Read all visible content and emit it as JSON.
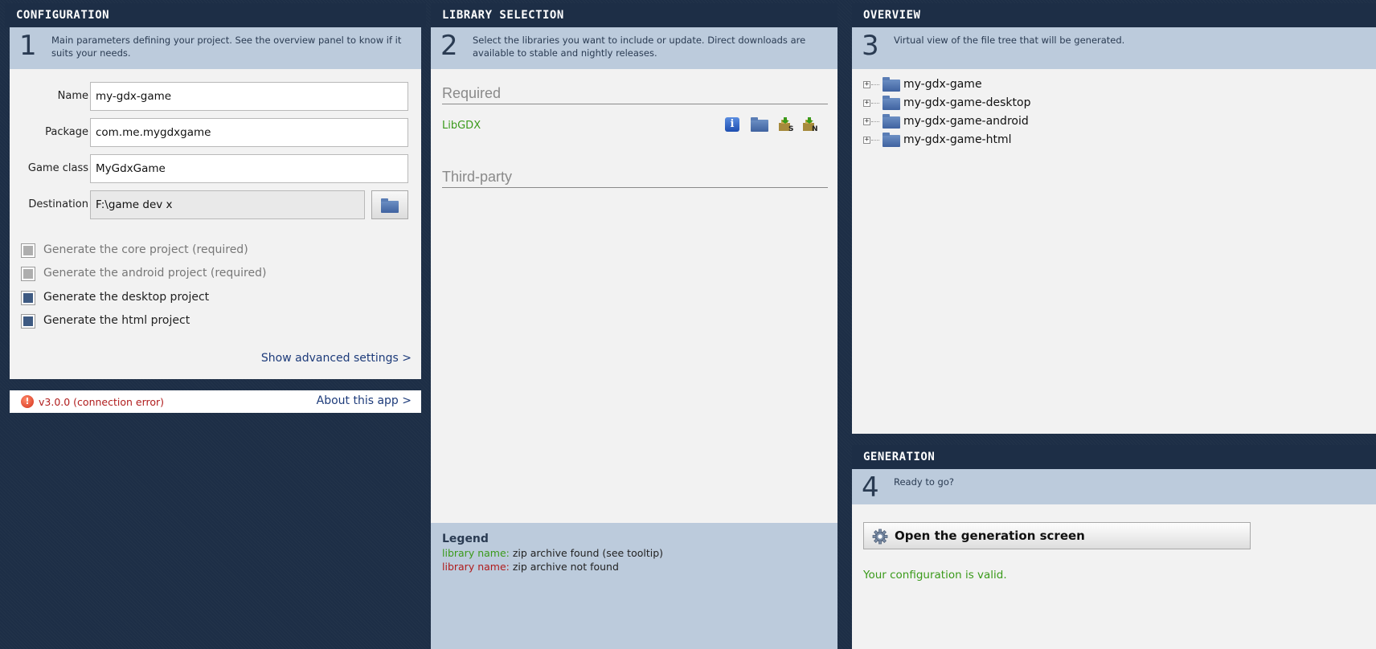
{
  "configuration": {
    "header": "CONFIGURATION",
    "step_number": "1",
    "step_text": "Main parameters defining your project. See the overview panel to know if it suits your needs.",
    "fields": {
      "name_label": "Name",
      "name_value": "my-gdx-game",
      "package_label": "Package",
      "package_value": "com.me.mygdxgame",
      "gameclass_label": "Game class",
      "gameclass_value": "MyGdxGame",
      "destination_label": "Destination",
      "destination_value": "F:\\game dev x"
    },
    "checkboxes": [
      {
        "label": "Generate the core project (required)",
        "checked": false,
        "disabled": true
      },
      {
        "label": "Generate the android project (required)",
        "checked": false,
        "disabled": true
      },
      {
        "label": "Generate the desktop project",
        "checked": true,
        "disabled": false
      },
      {
        "label": "Generate the html project",
        "checked": true,
        "disabled": false
      }
    ],
    "advanced_link": "Show advanced settings >",
    "status": {
      "version_text": "v3.0.0 (connection error)",
      "about_link": "About this app >"
    }
  },
  "library": {
    "header": "LIBRARY SELECTION",
    "step_number": "2",
    "step_text": "Select the libraries you want to include or update. Direct downloads are available to stable and nightly releases.",
    "required_title": "Required",
    "required_items": [
      {
        "name": "LibGDX",
        "icons": [
          "info-icon",
          "folder-icon",
          "stable-download-icon",
          "nightly-download-icon"
        ]
      }
    ],
    "thirdparty_title": "Third-party",
    "legend": {
      "title": "Legend",
      "found_name": "library name:",
      "found_text": " zip archive found (see tooltip)",
      "notfound_name": "library name:",
      "notfound_text": " zip archive not found"
    },
    "colors": {
      "found": "#3a9a1a",
      "not_found": "#b01c1c"
    }
  },
  "overview": {
    "header": "OVERVIEW",
    "step_number": "3",
    "step_text": "Virtual view of the file tree that will be generated.",
    "tree": [
      "my-gdx-game",
      "my-gdx-game-desktop",
      "my-gdx-game-android",
      "my-gdx-game-html"
    ]
  },
  "generation": {
    "header": "GENERATION",
    "step_number": "4",
    "step_text": "Ready to go?",
    "button_label": "Open the generation screen",
    "status_text": "Your configuration is valid."
  }
}
